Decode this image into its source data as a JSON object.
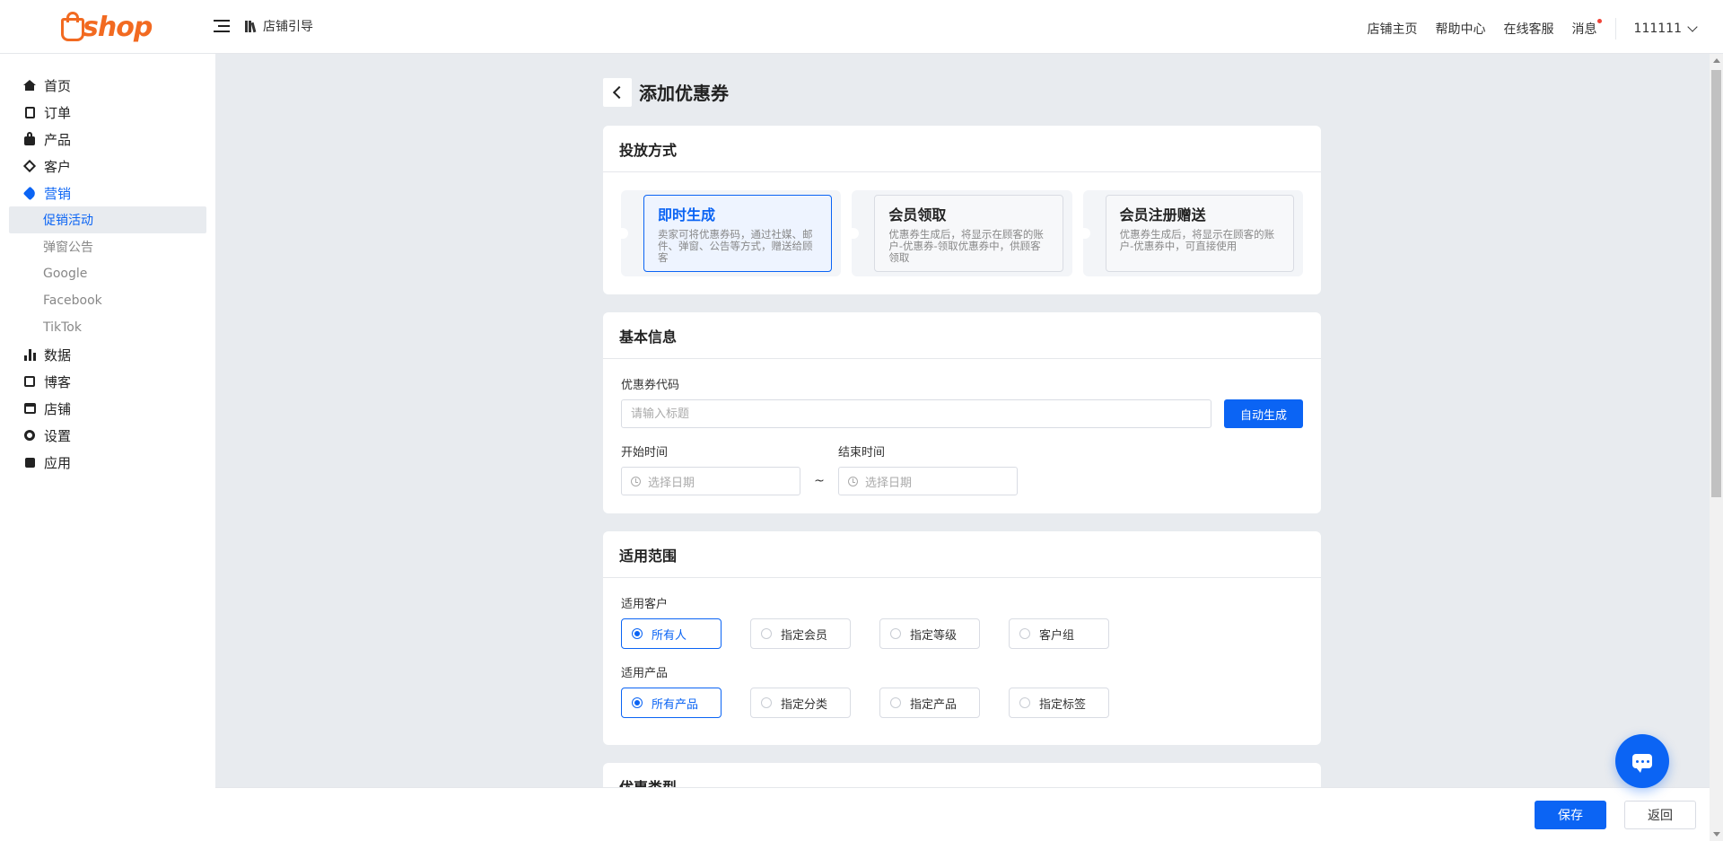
{
  "brand": {
    "logo_text": "shop",
    "accent": "#0b64f4",
    "logo_color": "#f26a21"
  },
  "topbar": {
    "guide_label": "店铺引导",
    "links": [
      "店铺主页",
      "帮助中心",
      "在线客服",
      "消息"
    ],
    "user": "111111"
  },
  "sidebar": {
    "items": [
      {
        "label": "首页",
        "icon": "home-icon"
      },
      {
        "label": "订单",
        "icon": "clipboard-icon"
      },
      {
        "label": "产品",
        "icon": "bag-icon"
      },
      {
        "label": "客户",
        "icon": "gem-icon"
      },
      {
        "label": "营销",
        "icon": "tag-icon"
      },
      {
        "label": "数据",
        "icon": "bar-chart-icon"
      },
      {
        "label": "博客",
        "icon": "edit-icon"
      },
      {
        "label": "店铺",
        "icon": "store-icon"
      },
      {
        "label": "设置",
        "icon": "gear-icon"
      },
      {
        "label": "应用",
        "icon": "puzzle-icon"
      }
    ],
    "marketing_sub": [
      "促销活动",
      "弹窗公告",
      "Google",
      "Facebook",
      "TikTok"
    ]
  },
  "page": {
    "title": "添加优惠券"
  },
  "delivery": {
    "title": "投放方式",
    "methods": [
      {
        "title": "即时生成",
        "desc": "卖家可将优惠券码，通过社媒、邮件、弹窗、公告等方式，赠送给顾客"
      },
      {
        "title": "会员领取",
        "desc": "优惠券生成后，将显示在顾客的账户-优惠券-领取优惠券中，供顾客领取"
      },
      {
        "title": "会员注册赠送",
        "desc": "优惠券生成后，将显示在顾客的账户-优惠券中，可直接使用"
      }
    ]
  },
  "basic": {
    "title": "基本信息",
    "code_label": "优惠券代码",
    "code_placeholder": "请输入标题",
    "auto_button": "自动生成",
    "start_label": "开始时间",
    "end_label": "结束时间",
    "date_placeholder": "选择日期",
    "range_sep": "~"
  },
  "scope": {
    "title": "适用范围",
    "customer_label": "适用客户",
    "customer_options": [
      "所有人",
      "指定会员",
      "指定等级",
      "客户组"
    ],
    "product_label": "适用产品",
    "product_options": [
      "所有产品",
      "指定分类",
      "指定产品",
      "指定标签"
    ]
  },
  "next_section": {
    "title": "优惠类型"
  },
  "footer": {
    "save": "保存",
    "back": "返回"
  }
}
